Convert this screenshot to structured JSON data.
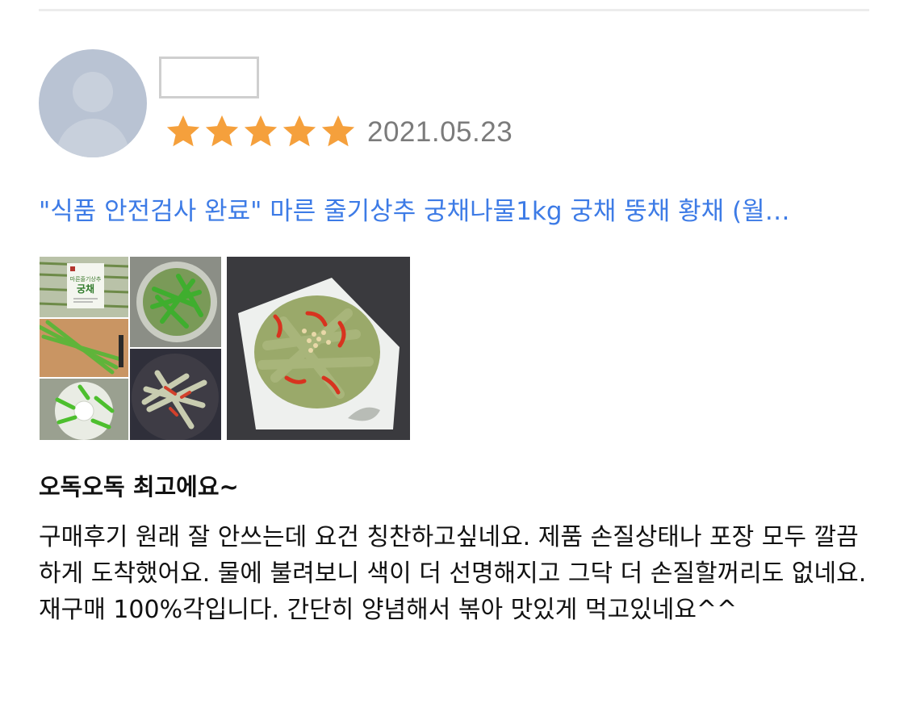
{
  "review": {
    "rating": 5,
    "rating_max": 5,
    "date": "2021.05.23",
    "product_title": "\"식품 안전검사 완료\" 마른 줄기상추 궁채나물1kg 궁채 뚱채 황채 (월…",
    "title": "오독오독 최고에요~",
    "body": "구매후기 원래 잘 안쓰는데 요건 칭찬하고싶네요. 제품 손질상태나 포장 모두 깔끔하게 도착했어요. 물에 불려보니 색이 더 선명해지고 그닥 더 손질할꺼리도 없네요. 재구매 100%각입니다. 간단히 양념해서 볶아 맛있게 먹고있네요^^",
    "package_label_line1": "마른줄기상추",
    "package_label_line2": "궁채"
  },
  "colors": {
    "star": "#f5a03c",
    "date": "#7b7b7b",
    "link": "#3d7be6",
    "avatar": "#b9c3d3"
  },
  "icons": {
    "avatar": "default-user-avatar",
    "star": "star-icon"
  }
}
